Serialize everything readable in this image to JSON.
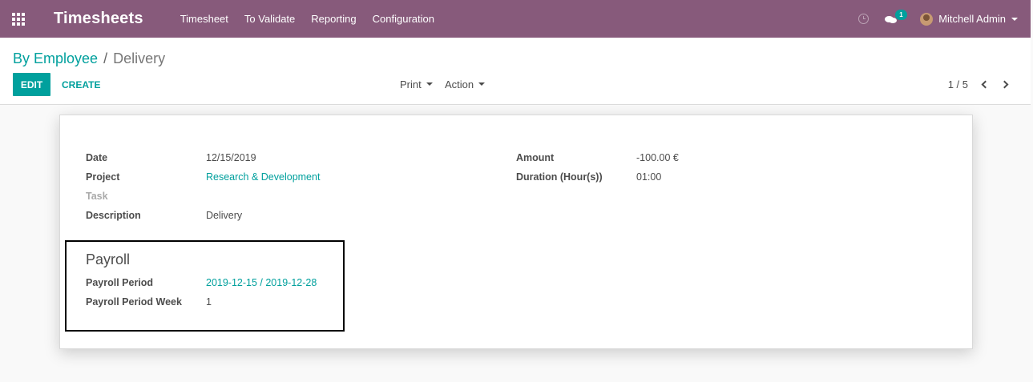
{
  "navbar": {
    "app_title": "Timesheets",
    "menu": [
      "Timesheet",
      "To Validate",
      "Reporting",
      "Configuration"
    ],
    "chat_badge": "1",
    "user_name": "Mitchell Admin",
    "brand_color": "#875a7b"
  },
  "breadcrumb": {
    "parent": "By Employee",
    "separator": "/",
    "current": "Delivery"
  },
  "toolbar": {
    "edit_label": "EDIT",
    "create_label": "CREATE",
    "print_label": "Print",
    "action_label": "Action",
    "pager": "1 / 5"
  },
  "form": {
    "left": [
      {
        "label": "Date",
        "value": "12/15/2019"
      },
      {
        "label": "Project",
        "value": "Research & Development"
      },
      {
        "label": "Task",
        "value": ""
      },
      {
        "label": "Description",
        "value": "Delivery"
      }
    ],
    "right": [
      {
        "label": "Amount",
        "value": "-100.00 €"
      },
      {
        "label": "Duration (Hour(s))",
        "value": "01:00"
      }
    ],
    "payroll": {
      "title": "Payroll",
      "fields": [
        {
          "label": "Payroll Period",
          "value": "2019-12-15 / 2019-12-28"
        },
        {
          "label": "Payroll Period Week",
          "value": "1"
        }
      ]
    }
  },
  "accent_color": "#00a09d"
}
